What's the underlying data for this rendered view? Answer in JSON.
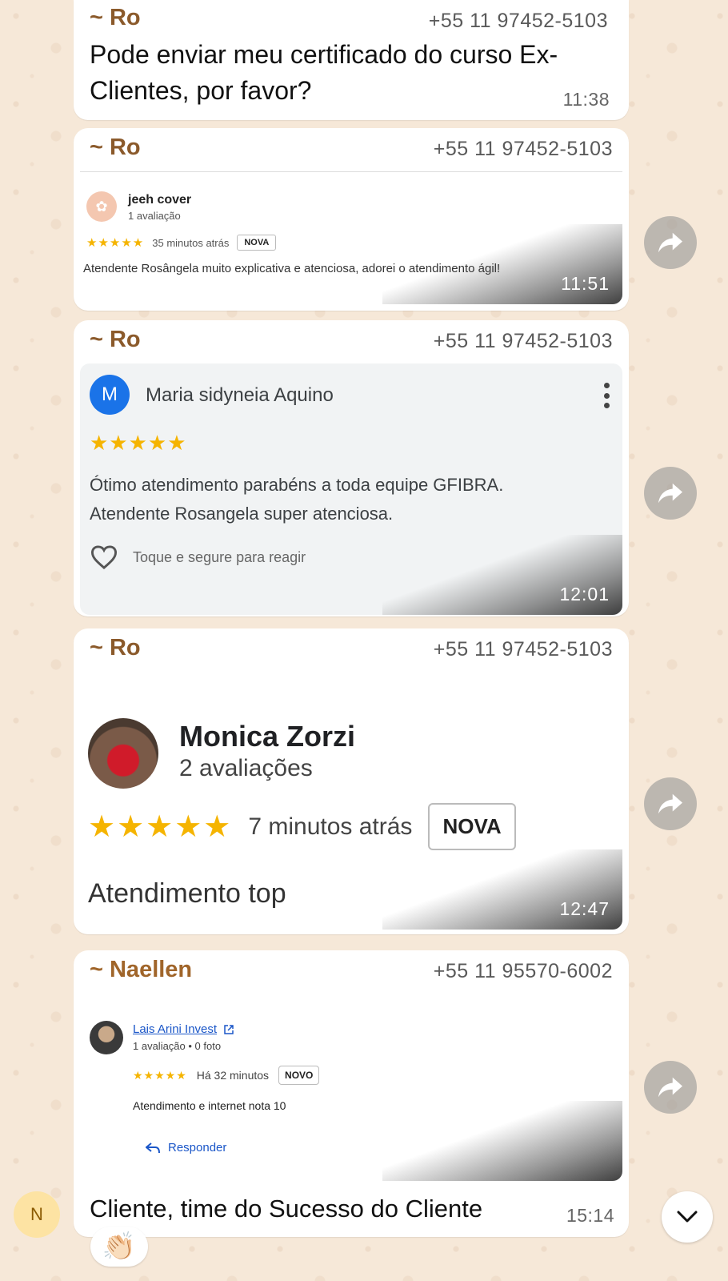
{
  "messages": {
    "m1": {
      "sender": "~ Ro",
      "phone": "+55 11 97452-5103",
      "text": "Pode enviar meu certificado do curso Ex-Clientes, por favor?",
      "time": "11:38"
    },
    "m2": {
      "sender": "~ Ro",
      "phone": "+55 11 97452-5103",
      "time": "11:51",
      "review": {
        "name": "jeeh cover",
        "meta": "1 avaliação",
        "stars": "★★★★★",
        "rating": 5,
        "when": "35 minutos atrás",
        "badge": "NOVA",
        "text": "Atendente Rosângela muito explicativa e atenciosa, adorei o atendimento ágil!"
      }
    },
    "m3": {
      "sender": "~ Ro",
      "phone": "+55 11 97452-5103",
      "time": "12:01",
      "review": {
        "avatar_letter": "M",
        "name": "Maria sidyneia Aquino",
        "stars": "★★★★★",
        "rating": 5,
        "text": "Ótimo atendimento parabéns a toda equipe GFIBRA. Atendente Rosangela super atenciosa.",
        "react_hint": "Toque e segure para reagir"
      }
    },
    "m4": {
      "sender": "~ Ro",
      "phone": "+55 11 97452-5103",
      "time": "12:47",
      "review": {
        "name": "Monica Zorzi",
        "meta": "2 avaliações",
        "stars": "★★★★★",
        "rating": 5,
        "when": "7 minutos atrás",
        "badge": "NOVA",
        "text": "Atendimento top"
      }
    },
    "m5": {
      "sender": "~ Naellen",
      "phone": "+55 11 95570-6002",
      "time": "15:14",
      "caption": "Cliente, time do Sucesso do Cliente",
      "review": {
        "name": "Lais Arini Invest",
        "meta": "1 avaliação • 0 foto",
        "stars": "★★★★★",
        "rating": 5,
        "when": "Há 32 minutos",
        "badge": "NOVO",
        "text": "Atendimento e internet nota 10",
        "reply": "Responder"
      }
    }
  },
  "footer": {
    "avatar_letter": "N",
    "reaction": "👏🏻"
  },
  "icons": {
    "forward": "forward-icon",
    "scroll_down": "chevron-down-icon"
  },
  "colors": {
    "wallpaper": "#f6e8d8",
    "sender": "#8b5a2b",
    "star": "#f5b400",
    "link": "#1a56c8",
    "avatar_m": "#1a73e8"
  }
}
